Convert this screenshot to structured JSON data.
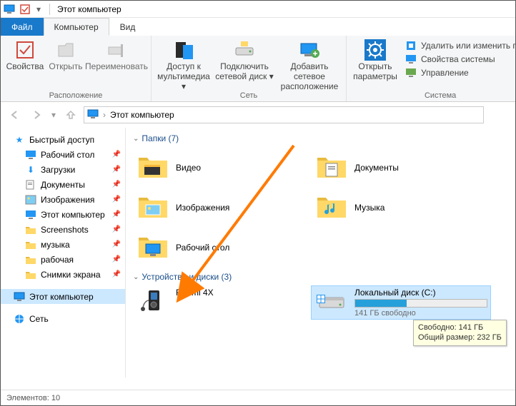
{
  "titlebar": {
    "title": "Этот компьютер"
  },
  "menu": {
    "file": "Файл",
    "computer": "Компьютер",
    "view": "Вид"
  },
  "ribbon": {
    "group_location": "Расположение",
    "group_network": "Сеть",
    "group_system": "Система",
    "btn_properties": "Свойства",
    "btn_open": "Открыть",
    "btn_rename": "Переименовать",
    "btn_media": "Доступ к мультимедиа ▾",
    "btn_map_drive": "Подключить сетевой диск ▾",
    "btn_add_netloc": "Добавить сетевое расположение",
    "btn_open_settings": "Открыть параметры",
    "side_uninstall": "Удалить или изменить про",
    "side_sysprops": "Свойства системы",
    "side_manage": "Управление"
  },
  "breadcrumb": {
    "root": "Этот компьютер"
  },
  "sidebar": {
    "quick": "Быстрый доступ",
    "items": [
      {
        "label": "Рабочий стол",
        "pin": true
      },
      {
        "label": "Загрузки",
        "pin": true
      },
      {
        "label": "Документы",
        "pin": true
      },
      {
        "label": "Изображения",
        "pin": true
      },
      {
        "label": "Этот компьютер",
        "pin": true
      },
      {
        "label": "Screenshots",
        "pin": true
      },
      {
        "label": "музыка",
        "pin": true
      },
      {
        "label": "рабочая",
        "pin": true
      },
      {
        "label": "Снимки экрана",
        "pin": true
      }
    ],
    "this_pc": "Этот компьютер",
    "network": "Сеть"
  },
  "content": {
    "group_folders": "Папки (7)",
    "group_drives": "Устройства и диски (3)",
    "folders": [
      {
        "label": "Видео"
      },
      {
        "label": "Документы"
      },
      {
        "label": "Изображения"
      },
      {
        "label": "Музыка"
      },
      {
        "label": "Рабочий стол"
      }
    ],
    "drives": [
      {
        "label": "Redmi 4X"
      },
      {
        "label": "Локальный диск (C:)",
        "sub": "141 ГБ свободно",
        "fill": 0.39
      }
    ],
    "tooltip_line1": "Свободно: 141 ГБ",
    "tooltip_line2": "Общий размер: 232 ГБ"
  },
  "status": {
    "count": "Элементов: 10"
  }
}
